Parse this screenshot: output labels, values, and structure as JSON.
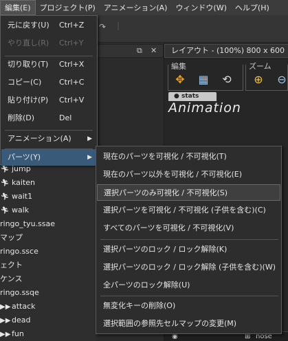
{
  "menubar": {
    "items": [
      {
        "label": "編集(E)"
      },
      {
        "label": "プロジェクト(P)"
      },
      {
        "label": "アニメーション(A)"
      },
      {
        "label": "ウィンドウ(W)"
      },
      {
        "label": "ヘルプ(H)"
      }
    ]
  },
  "edit_menu": {
    "items": [
      {
        "label": "元に戻す(U)",
        "shortcut": "Ctrl+Z"
      },
      {
        "label": "やり直し(R)",
        "shortcut": "Ctrl+Y"
      },
      {
        "label": "切り取り(T)",
        "shortcut": "Ctrl+X"
      },
      {
        "label": "コピー(C)",
        "shortcut": "Ctrl+C"
      },
      {
        "label": "貼り付け(P)",
        "shortcut": "Ctrl+V"
      },
      {
        "label": "削除(D)",
        "shortcut": "Del"
      },
      {
        "label": "アニメーション(A)"
      },
      {
        "label": "パーツ(Y)"
      }
    ]
  },
  "parts_submenu": {
    "items": [
      {
        "label": "現在のパーツを可視化 / 不可視化(T)"
      },
      {
        "label": "現在のパーツ以外を可視化 / 不可視化(E)"
      },
      {
        "label": "選択パーツのみ可視化 / 不可視化(S)"
      },
      {
        "label": "選択パーツを可視化 / 不可視化 (子供を含む)(C)"
      },
      {
        "label": "すべてのパーツを可視化 / 不可視化(V)"
      },
      {
        "label": "選択パーツのロック / ロック解除(K)"
      },
      {
        "label": "選択パーツのロック / ロック解除 (子供を含む)(W)"
      },
      {
        "label": "全パーツのロック解除(U)"
      },
      {
        "label": "無変化キーの削除(O)"
      },
      {
        "label": "選択範囲の参照先セルマップの変更(M)"
      }
    ]
  },
  "viewport": {
    "title": "レイアウト - (100%) 800 x 600",
    "group_edit": "編集",
    "group_zoom": "ズーム",
    "tag": "● stats",
    "animation_title": "Animation",
    "bottom_label": "nose"
  },
  "left_tree": {
    "rows": [
      {
        "label": "jump",
        "icon": "person-icon"
      },
      {
        "label": "kaiten",
        "icon": "person-icon"
      },
      {
        "label": "wait1",
        "icon": "person-icon"
      },
      {
        "label": "walk",
        "icon": "person-icon"
      },
      {
        "label": "ringo_tyu.ssae",
        "icon": ""
      },
      {
        "label": "マップ",
        "icon": ""
      },
      {
        "label": "ringo.ssce",
        "icon": ""
      },
      {
        "label": "ェクト",
        "icon": ""
      },
      {
        "label": "ケンス",
        "icon": ""
      },
      {
        "label": "ringo.ssqe",
        "icon": ""
      },
      {
        "label": "attack",
        "icon": "play-icon"
      },
      {
        "label": "dead",
        "icon": "play-icon"
      },
      {
        "label": "fun",
        "icon": "play-icon"
      }
    ]
  },
  "colors": {
    "highlight_blue": "#3a5a7a",
    "menu_bg": "#2d2d2d",
    "accent_orange": "#f0a020"
  }
}
